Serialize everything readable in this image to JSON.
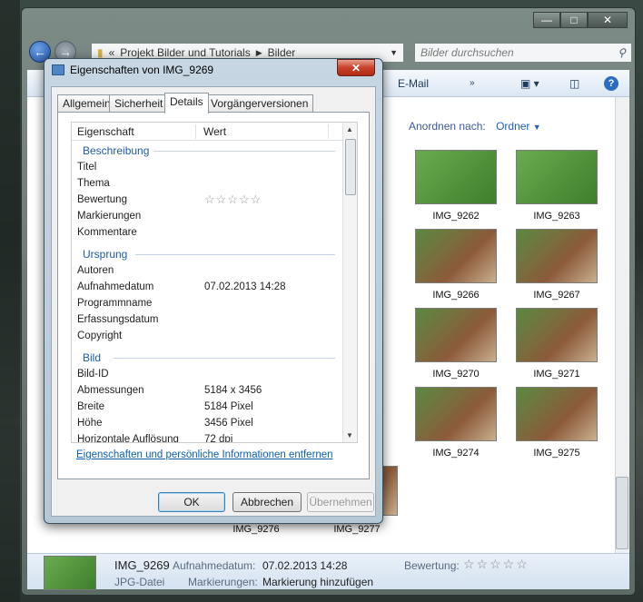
{
  "explorer": {
    "address": {
      "prefix": "«",
      "segments": [
        "Projekt Bilder und Tutorials",
        "Bilder"
      ]
    },
    "search_placeholder": "Bilder durchsuchen",
    "toolbar": {
      "email": "E-Mail"
    },
    "arrange_label": "Anordnen nach:",
    "arrange_value": "Ordner",
    "thumbnails": [
      {
        "name": "IMG_9262"
      },
      {
        "name": "IMG_9263"
      },
      {
        "name": "IMG_9266"
      },
      {
        "name": "IMG_9267"
      },
      {
        "name": "IMG_9270"
      },
      {
        "name": "IMG_9271"
      },
      {
        "name": "IMG_9274"
      },
      {
        "name": "IMG_9275"
      },
      {
        "name": "IMG_9276"
      },
      {
        "name": "IMG_9277"
      }
    ],
    "details_pane": {
      "name": "IMG_9269",
      "type": "JPG-Datei",
      "date_label": "Aufnahmedatum:",
      "date_value": "07.02.2013 14:28",
      "tags_label": "Markierungen:",
      "tags_value": "Markierung hinzufügen",
      "rating_label": "Bewertung:",
      "rating_stars": "☆☆☆☆☆"
    }
  },
  "dialog": {
    "title": "Eigenschaften von IMG_9269",
    "close_glyph": "✕",
    "tabs": [
      "Allgemein",
      "Sicherheit",
      "Details",
      "Vorgängerversionen"
    ],
    "active_tab": "Details",
    "columns": {
      "property": "Eigenschaft",
      "value": "Wert"
    },
    "groups": {
      "description": "Beschreibung",
      "origin": "Ursprung",
      "image": "Bild"
    },
    "description_rows": [
      {
        "k": "Titel",
        "v": ""
      },
      {
        "k": "Thema",
        "v": ""
      },
      {
        "k": "Bewertung",
        "v": "☆☆☆☆☆"
      },
      {
        "k": "Markierungen",
        "v": ""
      },
      {
        "k": "Kommentare",
        "v": ""
      }
    ],
    "origin_rows": [
      {
        "k": "Autoren",
        "v": ""
      },
      {
        "k": "Aufnahmedatum",
        "v": "07.02.2013 14:28"
      },
      {
        "k": "Programmname",
        "v": ""
      },
      {
        "k": "Erfassungsdatum",
        "v": ""
      },
      {
        "k": "Copyright",
        "v": ""
      }
    ],
    "image_rows": [
      {
        "k": "Bild-ID",
        "v": ""
      },
      {
        "k": "Abmessungen",
        "v": "5184 x 3456"
      },
      {
        "k": "Breite",
        "v": "5184 Pixel"
      },
      {
        "k": "Höhe",
        "v": "3456 Pixel"
      },
      {
        "k": "Horizontale Auflösung",
        "v": "72 dpi"
      }
    ],
    "remove_link": "Eigenschaften und persönliche Informationen entfernen",
    "buttons": {
      "ok": "OK",
      "cancel": "Abbrechen",
      "apply": "Übernehmen"
    }
  }
}
